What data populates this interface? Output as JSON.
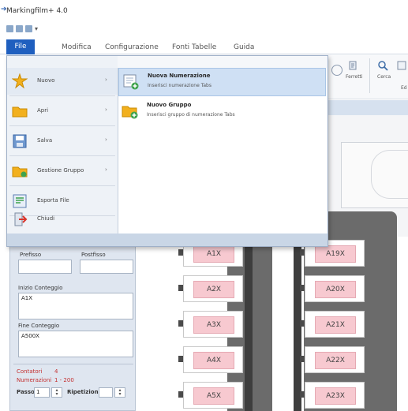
{
  "window": {
    "title": "Markingfilm+ 4.0"
  },
  "ribbon": {
    "tabs": [
      {
        "label": "File"
      },
      {
        "label": "Modifica"
      },
      {
        "label": "Configurazione"
      },
      {
        "label": "Fonti Tabelle"
      },
      {
        "label": "Guida"
      }
    ],
    "right_labels": [
      "Ferretti",
      "Cerca",
      "Ed"
    ]
  },
  "file_menu": {
    "items": [
      {
        "label": "Nuovo",
        "icon": "new-star-icon",
        "has_submenu": true
      },
      {
        "label": "Apri",
        "icon": "folder-open-icon",
        "has_submenu": true
      },
      {
        "label": "Salva",
        "icon": "save-icon",
        "has_submenu": true
      },
      {
        "label": "Gestione Gruppo",
        "icon": "folder-group-icon",
        "has_submenu": true
      },
      {
        "label": "Esporta File",
        "icon": "export-icon",
        "has_submenu": false
      },
      {
        "label": "Chiudi",
        "icon": "exit-icon",
        "has_submenu": false
      }
    ],
    "submenu": [
      {
        "title": "Nuova Numerazione",
        "description": "Inserisci numerazione Tabs",
        "icon": "new-numbering-icon"
      },
      {
        "title": "Nuovo Gruppo",
        "description": "Inserisci gruppo di numerazione Tabs",
        "icon": "new-group-icon"
      }
    ]
  },
  "left_panel": {
    "prefix_label": "Prefisso",
    "suffix_label": "Postfisso",
    "start_label": "Inizio Conteggio",
    "start_value": "A1X",
    "end_label": "Fine Conteggio",
    "end_value": "A500X",
    "count_label": "Contatori",
    "count_value": "4",
    "range_label": "Numerazioni",
    "range_value": "1 - 200",
    "step_label": "Passo",
    "step_value": "1",
    "repeat_label": "Ripetizioni"
  },
  "canvas": {
    "left_column": [
      "A1X",
      "A2X",
      "A3X",
      "A4X",
      "A5X"
    ],
    "right_column": [
      "A19X",
      "A20X",
      "A21X",
      "A22X",
      "A23X"
    ]
  },
  "colors": {
    "accent": "#1f5fbf",
    "label_fill": "#f7c9d0",
    "board": "#6b6b6b"
  }
}
